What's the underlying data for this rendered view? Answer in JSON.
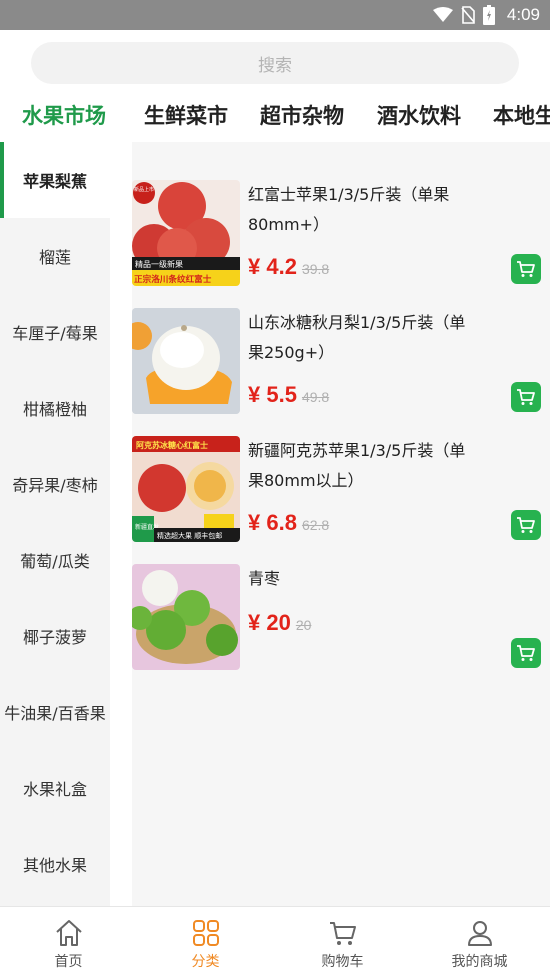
{
  "status_bar": {
    "time": "4:09",
    "icons": [
      "wifi-icon",
      "no-sim-icon",
      "battery-icon"
    ]
  },
  "search": {
    "placeholder": "搜索"
  },
  "top_tabs": [
    {
      "label": "水果市场",
      "active": true
    },
    {
      "label": "生鲜菜市",
      "active": false
    },
    {
      "label": "超市杂物",
      "active": false
    },
    {
      "label": "酒水饮料",
      "active": false
    },
    {
      "label": "本地生",
      "active": false
    }
  ],
  "sidebar": {
    "items": [
      {
        "label": "苹果梨蕉",
        "active": true
      },
      {
        "label": "榴莲",
        "active": false
      },
      {
        "label": "车厘子/莓果",
        "active": false
      },
      {
        "label": "柑橘橙柚",
        "active": false
      },
      {
        "label": "奇异果/枣柿",
        "active": false
      },
      {
        "label": "葡萄/瓜类",
        "active": false
      },
      {
        "label": "椰子菠萝",
        "active": false
      },
      {
        "label": "牛油果/百香果",
        "active": false
      },
      {
        "label": "水果礼盒",
        "active": false
      },
      {
        "label": "其他水果",
        "active": false
      }
    ]
  },
  "products": [
    {
      "name": "红富士苹果1/3/5斤装（单果80mm+）",
      "price": "¥ 4.2",
      "old_price": "39.8",
      "image_texts": {
        "badge": "新品上市",
        "line1": "精品一级新果",
        "line2": "正宗洛川条纹红富士"
      }
    },
    {
      "name": "山东冰糖秋月梨1/3/5斤装（单果250g+）",
      "price": "¥ 5.5",
      "old_price": "49.8"
    },
    {
      "name": "新疆阿克苏苹果1/3/5斤装（单果80mm以上）",
      "price": "¥ 6.8",
      "old_price": "62.8",
      "image_texts": {
        "banner": "阿克苏冰糖心红富士",
        "tag": "新疆直发",
        "line1": "精选超大果  顺丰包邮"
      }
    },
    {
      "name": "青枣",
      "price": "¥ 20",
      "old_price": "20"
    }
  ],
  "bottom_nav": [
    {
      "label": "首页",
      "icon": "home-icon",
      "active": false
    },
    {
      "label": "分类",
      "icon": "category-icon",
      "active": true
    },
    {
      "label": "购物车",
      "icon": "cart-icon",
      "active": false
    },
    {
      "label": "我的商城",
      "icon": "user-icon",
      "active": false
    }
  ],
  "colors": {
    "accent_green": "#1f9a4a",
    "cart_green": "#27b24f",
    "price_red": "#e2231a",
    "nav_active": "#f08a24"
  }
}
